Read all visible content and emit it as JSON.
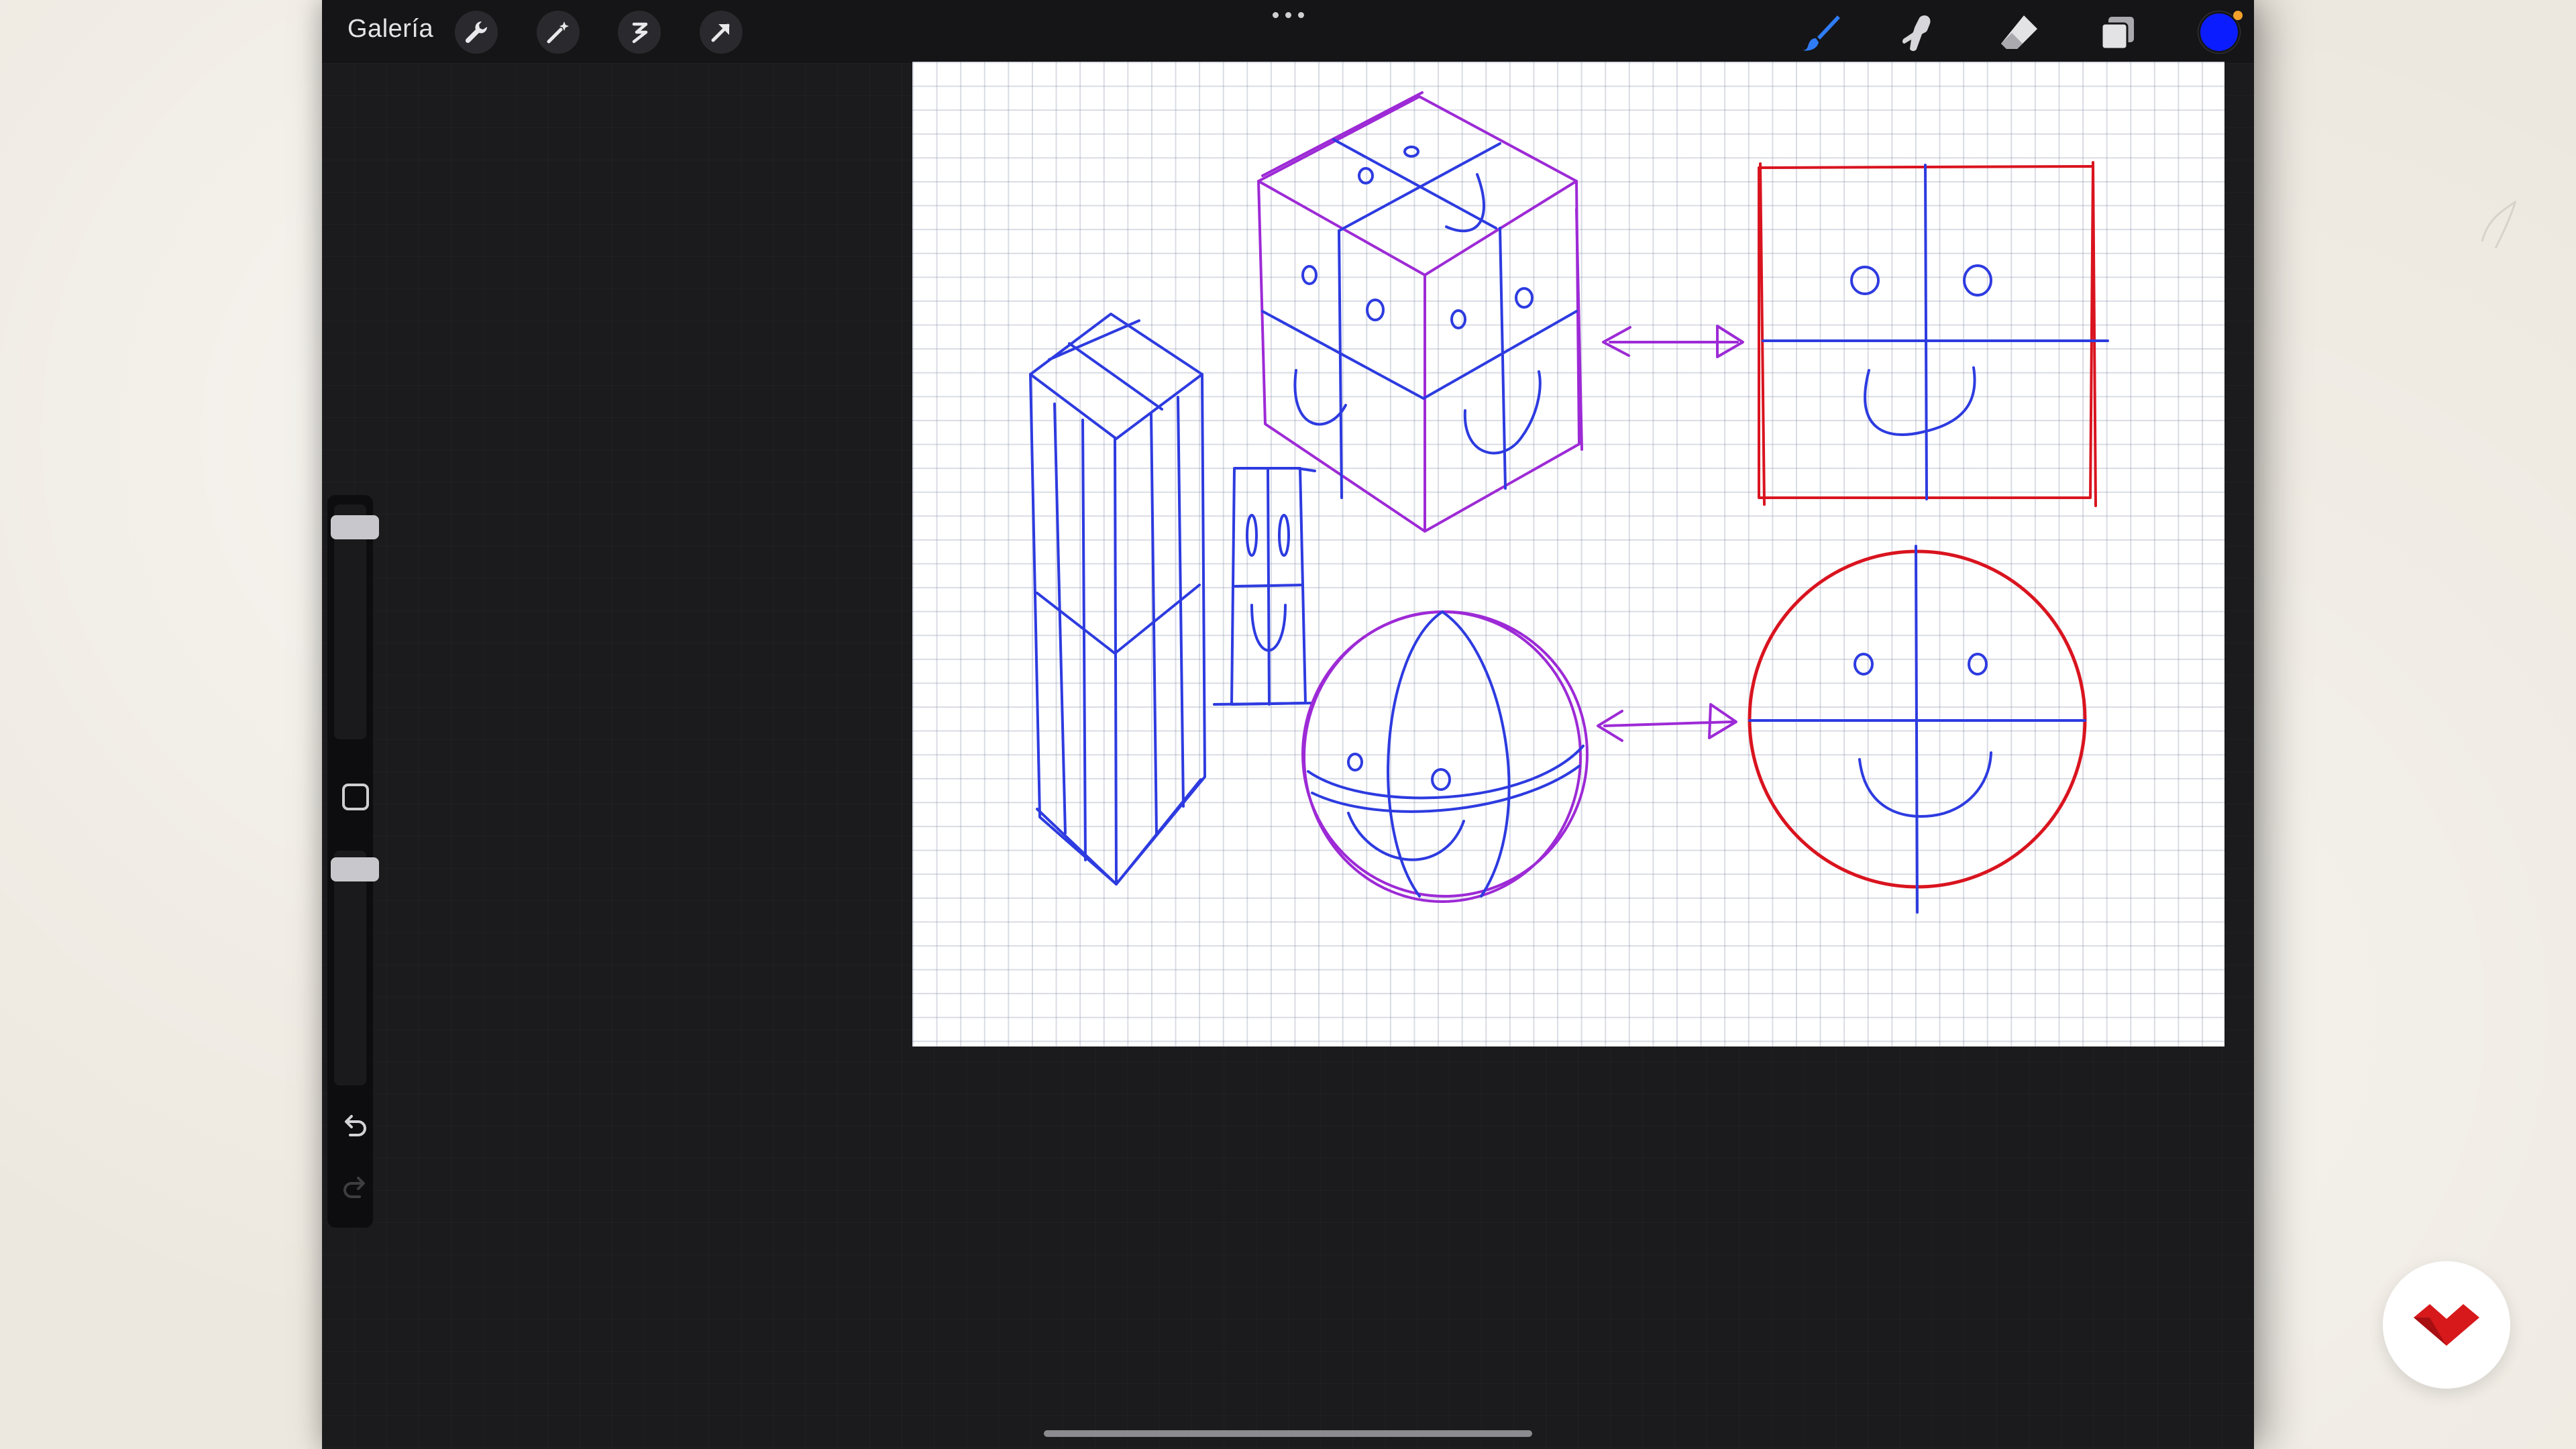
{
  "topbar": {
    "gallery_label": "Galería",
    "left_tools": [
      "actions-wrench-icon",
      "adjustments-magic-wand-icon",
      "selection-icon",
      "transform-arrow-icon"
    ],
    "right_tools": [
      "brush-icon",
      "smudge-icon",
      "eraser-icon",
      "layers-icon"
    ],
    "current_color": "#0b1dff"
  },
  "sidebar": {
    "controls": [
      "brush-size-slider",
      "modify-button",
      "opacity-slider",
      "undo-icon",
      "redo-icon"
    ]
  },
  "canvas": {
    "content": "sketch"
  },
  "colors": {
    "ink_blue": "#2d3be0",
    "ink_purple": "#9d2ad6",
    "ink_red": "#d9141f",
    "logo_red": "#d7191c"
  }
}
